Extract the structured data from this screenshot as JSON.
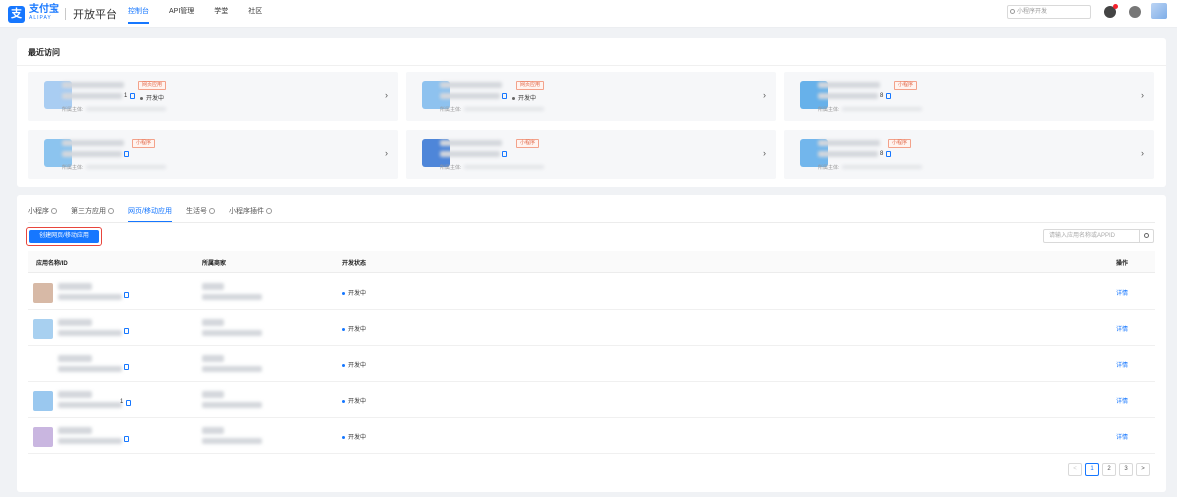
{
  "brand": {
    "mark": "支",
    "name_cn": "支付宝",
    "name_en": "ALIPAY",
    "platform": "开放平台"
  },
  "nav": {
    "items": [
      "控制台",
      "API管理",
      "学堂",
      "社区"
    ],
    "active": 0
  },
  "header_search": {
    "placeholder": "小程序开发"
  },
  "recent": {
    "title": "最近访问",
    "owner_label": "所属主体:",
    "cards": [
      {
        "tag": "网页应用",
        "status": "开发中",
        "suffix": "1",
        "logo": "#a9cdf2"
      },
      {
        "tag": "网页应用",
        "status": "开发中",
        "suffix": "",
        "logo": "#8ec2ef"
      },
      {
        "tag": "小程序",
        "status": "",
        "suffix": "8",
        "logo": "#67b1ea"
      },
      {
        "tag": "小程序",
        "status": "",
        "suffix": "",
        "logo": "#8cc4ef"
      },
      {
        "tag": "小程序",
        "status": "",
        "suffix": "",
        "logo": "#4e86d9"
      },
      {
        "tag": "小程序",
        "status": "",
        "suffix": "8",
        "logo": "#72b6ec"
      }
    ]
  },
  "tabs": [
    {
      "label": "小程序",
      "info": true
    },
    {
      "label": "第三方应用",
      "info": true
    },
    {
      "label": "网页/移动应用",
      "info": false
    },
    {
      "label": "生活号",
      "info": true
    },
    {
      "label": "小程序插件",
      "info": true
    }
  ],
  "active_tab": 2,
  "create_button": "创建网页/移动应用",
  "app_search": {
    "placeholder": "请输入应用名称或APPID"
  },
  "table": {
    "columns": [
      "应用名称/ID",
      "所属商家",
      "开发状态",
      "操作"
    ],
    "rows": [
      {
        "suffix": "",
        "status": "开发中",
        "action": "详情",
        "logo": "#d7b9a6"
      },
      {
        "suffix": "",
        "status": "开发中",
        "action": "详情",
        "logo": "#a8d0f0"
      },
      {
        "suffix": "",
        "status": "开发中",
        "action": "详情",
        "logo": "#ffffff"
      },
      {
        "suffix": "1",
        "status": "开发中",
        "action": "详情",
        "logo": "#9ac8ef"
      },
      {
        "suffix": "",
        "status": "开发中",
        "action": "详情",
        "logo": "#c9b6e0"
      }
    ]
  },
  "pagination": {
    "prev": "<",
    "pages": [
      "1",
      "2",
      "3"
    ],
    "next": ">",
    "current": 0
  },
  "colors": {
    "primary": "#1677ff",
    "tag": "#e2694a",
    "highlight": "#e8453c"
  }
}
